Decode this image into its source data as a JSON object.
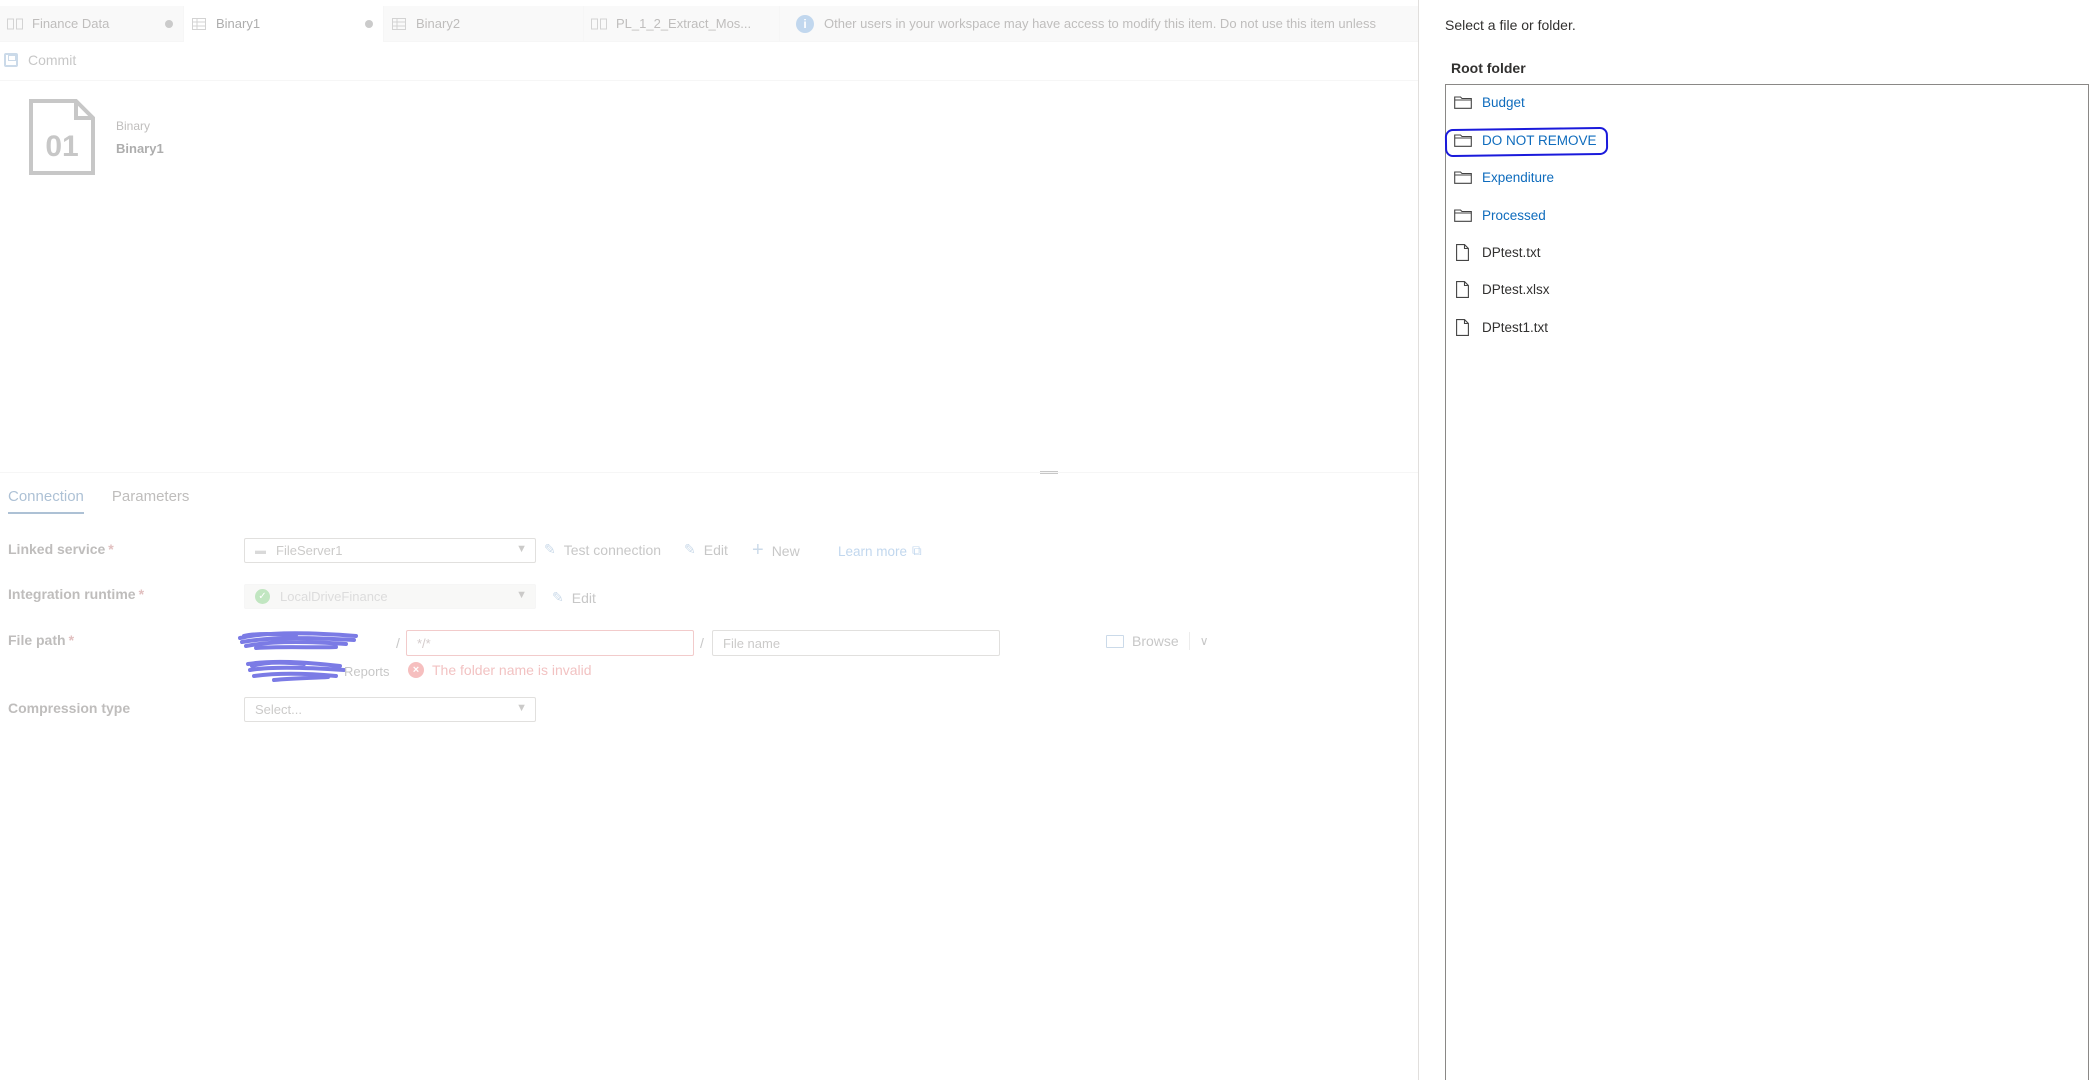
{
  "tabs": [
    {
      "label": "Finance Data",
      "active": false,
      "unsaved": true
    },
    {
      "label": "Binary1",
      "active": true,
      "unsaved": true
    },
    {
      "label": "Binary2",
      "active": false,
      "unsaved": false
    },
    {
      "label": "PL_1_2_Extract_Mos...",
      "active": false,
      "unsaved": false
    }
  ],
  "info_banner": "Other users in your workspace may have access to modify this item. Do not use this item unless",
  "toolbar": {
    "commit_label": "Commit"
  },
  "dataset": {
    "icon_text": "01",
    "type": "Binary",
    "name": "Binary1"
  },
  "properties_tabs": [
    "Connection",
    "Parameters"
  ],
  "connection": {
    "linked_service": {
      "label": "Linked service",
      "value": "FileServer1",
      "test_connection": "Test connection",
      "edit": "Edit",
      "new": "New",
      "learn_more": "Learn more"
    },
    "integration_runtime": {
      "label": "Integration runtime",
      "value": "LocalDriveFinance",
      "edit": "Edit"
    },
    "file_path": {
      "label": "File path",
      "separator": "/",
      "folder_value": "*/*",
      "file_placeholder": "File name",
      "path_tail": "Reports",
      "error": "The folder name is invalid",
      "browse": "Browse"
    },
    "compression": {
      "label": "Compression type",
      "placeholder": "Select..."
    },
    "required_marker": "*"
  },
  "panel": {
    "title": "Select a file or folder.",
    "root_label": "Root folder",
    "folders": [
      "Budget",
      "DO NOT REMOVE",
      "Expenditure",
      "Processed"
    ],
    "files": [
      "DPtest.txt",
      "DPtest.xlsx",
      "DPtest1.txt"
    ]
  },
  "colors": {
    "link": "#0f6cbd",
    "annotation": "#1a1adb",
    "error": "#e89090",
    "redaction": "#1010d0"
  }
}
